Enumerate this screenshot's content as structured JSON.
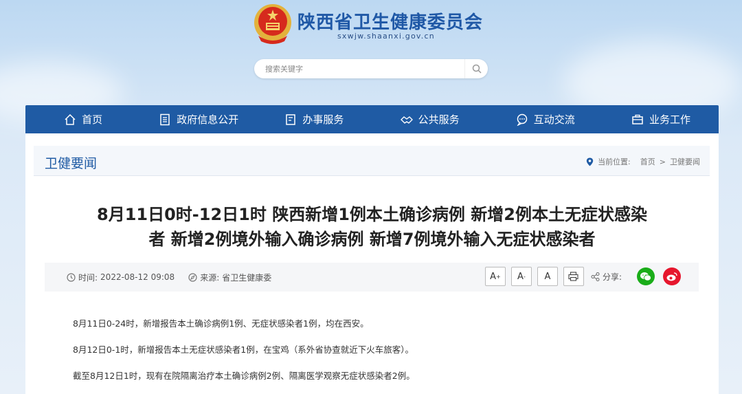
{
  "header": {
    "site_title": "陕西省卫生健康委员会",
    "site_url": "sxwjw.shaanxi.gov.cn"
  },
  "search": {
    "placeholder": "搜索关键字"
  },
  "nav": {
    "items": [
      {
        "label": "首页",
        "icon": "home-icon"
      },
      {
        "label": "政府信息公开",
        "icon": "document-icon"
      },
      {
        "label": "办事服务",
        "icon": "list-icon"
      },
      {
        "label": "公共服务",
        "icon": "handshake-icon"
      },
      {
        "label": "互动交流",
        "icon": "chat-icon"
      },
      {
        "label": "业务工作",
        "icon": "briefcase-icon"
      }
    ]
  },
  "section": {
    "title": "卫健要闻"
  },
  "breadcrumb": {
    "prefix": "当前位置:",
    "home": "首页",
    "separator": ">",
    "current": "卫健要闻"
  },
  "article": {
    "title_line1": "8月11日0时-12日1时 陕西新增1例本土确诊病例 新增2例本土无症状感染",
    "title_line2": "者 新增2例境外输入确诊病例 新增7例境外输入无症状感染者",
    "time_label": "时间:",
    "time_value": "2022-08-12 09:08",
    "source_label": "来源:",
    "source_value": "省卫生健康委",
    "font_large": "A",
    "font_large_sup": "+",
    "font_small": "A",
    "font_small_sup": "-",
    "font_reset": "A",
    "share_label": "分享:",
    "paragraphs": [
      "8月11日0-24时，新增报告本土确诊病例1例、无症状感染者1例，均在西安。",
      "8月12日0-1时，新增报告本土无症状感染者1例，在宝鸡（系外省协查就近下火车旅客）。",
      "截至8月12日1时，现有在院隔离治疗本土确诊病例2例、隔离医学观察无症状感染者2例。"
    ]
  },
  "colors": {
    "nav_bg": "#1f5ba4",
    "title_blue": "#1f58a6",
    "wechat": "#1aad19",
    "weibo": "#e6162d"
  }
}
